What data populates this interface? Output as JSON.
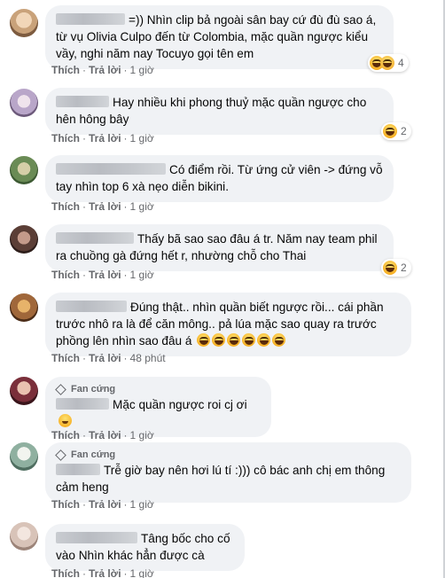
{
  "actions": {
    "like": "Thích",
    "reply": "Trả lời",
    "sep": "·"
  },
  "comments": [
    {
      "text": "=)) Nhìn clip bả ngoài sân bay cứ đù đù sao á, từ vụ Olivia Culpo đến từ Colombia, mặc quần ngược kiểu vầy, nghi năm nay Tocuyo gọi tên em",
      "time": "1 giờ",
      "reaction_count": "4",
      "avatar_color": "#c9a27a"
    },
    {
      "text": "Hay nhiều khi phong thuỷ mặc quần ngược cho hên hông bây",
      "time": "1 giờ",
      "reaction_count": "2",
      "avatar_color": "#b9a6c9"
    },
    {
      "text": "Có điểm rồi. Từ ứng cử viên -> đứng vỗ tay nhìn top 6 xà nẹo diễn bikini.",
      "time": "1 giờ",
      "avatar_color": "#6a8b55"
    },
    {
      "text": "Thấy bã sao sao đâu á tr. Năm nay team phil ra chuồng gà đứng hết r, nhường chỗ cho Thai",
      "time": "1 giờ",
      "reaction_count": "2",
      "avatar_color": "#5b3e36"
    },
    {
      "text": "Đúng thật.. nhìn quần biết ngược rồi... cái phần trước nhô ra là để căn mông.. pả lúa mặc sao quay ra trước phồng lên nhìn sao đâu á",
      "time": "48 phút",
      "avatar_color": "#a0673a"
    },
    {
      "badge": "Fan cứng",
      "text": "Mặc quần ngược roi cj ơi",
      "time": "1 giờ",
      "avatar_color": "#7a2f3a"
    },
    {
      "badge": "Fan cứng",
      "text": "Trễ giờ bay nên hơi lú tí :))) cô bác anh chị em thông cảm heng",
      "time": "1 giờ",
      "avatar_color": "#8fb0a0"
    },
    {
      "text": "Tâng bốc cho cố vào Nhìn khác hẳn được cà",
      "time": "1 giờ",
      "avatar_color": "#d8c3b8"
    }
  ]
}
